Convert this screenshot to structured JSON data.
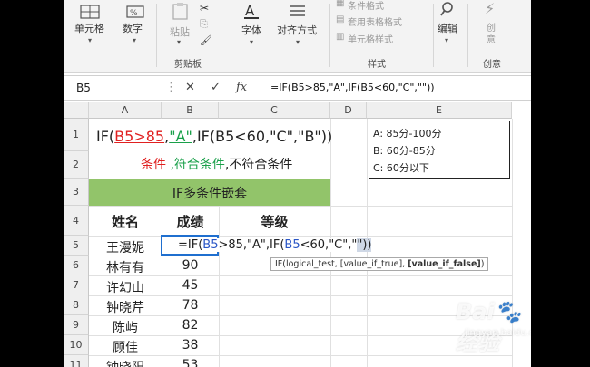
{
  "ribbon": {
    "cells_label": "单元格",
    "number_label": "数字",
    "paste_label": "粘贴",
    "clipboard_label": "剪贴板",
    "font_label": "字体",
    "align_label": "对齐方式",
    "cond_format_label": "条件格式",
    "table_format_label": "套用表格格式",
    "cell_style_label": "单元格样式",
    "styles_label": "样式",
    "edit_label": "编辑",
    "create_label": "创",
    "create_label2": "意",
    "creative_label": "创意"
  },
  "formula_bar": {
    "name_box": "B5",
    "formula": "=IF(B5>85,\"A\",IF(B5<60,\"C\",\"\"))"
  },
  "columns": [
    "A",
    "B",
    "C",
    "D",
    "E"
  ],
  "rows": [
    "1",
    "2",
    "3",
    "4",
    "5",
    "6",
    "7",
    "8",
    "9",
    "10",
    "11"
  ],
  "sheet": {
    "r1_formula_prefix": "IF(",
    "r1_cond": "B5>85",
    "r1_comma": ",",
    "r1_true": "\"A\"",
    "r1_rest": ",IF(B5<60,\"C\",\"B\"))",
    "r2_cond": "条件",
    "r2_true": ",符合条件",
    "r2_false": ",不符合条件",
    "r3_title": "IF多条件嵌套",
    "header_name": "姓名",
    "header_score": "成绩",
    "header_grade": "等级",
    "editing_prefix": "=IF(",
    "editing_ref1": "B5",
    "editing_mid": ">85,\"A\",IF(",
    "editing_ref2": "B5",
    "editing_tail": "<60,\"C\",\"",
    "editing_end": "\"))",
    "students": [
      {
        "name": "王漫妮",
        "score": ""
      },
      {
        "name": "林有有",
        "score": "90"
      },
      {
        "name": "许幻山",
        "score": "45"
      },
      {
        "name": "钟晓芹",
        "score": "78"
      },
      {
        "name": "陈屿",
        "score": "82"
      },
      {
        "name": "顾佳",
        "score": "38"
      },
      {
        "name": "钟晓阳",
        "score": "53"
      }
    ]
  },
  "legend": {
    "line_a": "A:  85分-100分",
    "line_b": "B:   60分-85分",
    "line_c": "C:   60分以下"
  },
  "tooltip": {
    "text": "IF(logical_test, [value_if_true], ",
    "bold": "[value_if_false]",
    "close": ")"
  },
  "watermark": {
    "brand": "Bai",
    "brand2": "经验",
    "sub": "jingyan.baidu.com"
  }
}
